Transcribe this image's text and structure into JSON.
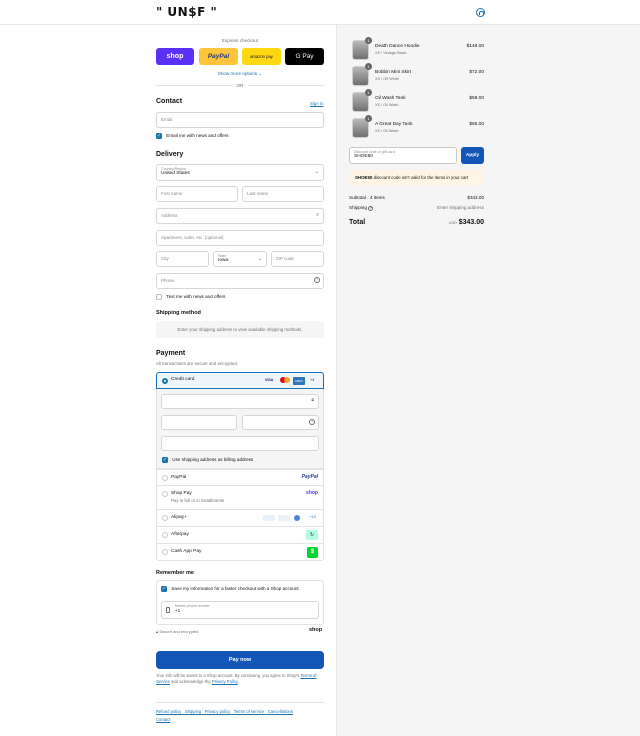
{
  "brand": {
    "logo": "\" UN$F \""
  },
  "express": {
    "title": "Express checkout",
    "shop": "shop",
    "paypal": "PayPal",
    "amazon": "amazon pay",
    "gpay": "G Pay",
    "more": "Show more options",
    "or": "OR"
  },
  "contact": {
    "heading": "Contact",
    "signin": "Sign in",
    "email_placeholder": "Email",
    "news_label": "Email me with news and offers"
  },
  "delivery": {
    "heading": "Delivery",
    "country_label": "Country/Region",
    "country_value": "United States",
    "first_name": "First name",
    "last_name": "Last name",
    "address": "Address",
    "apartment": "Apartment, suite, etc. (optional)",
    "city": "City",
    "state_label": "State",
    "state_value": "Iowa",
    "zip": "ZIP code",
    "phone": "Phone",
    "text_label": "Text me with news and offers"
  },
  "shipping": {
    "heading": "Shipping method",
    "note": "Enter your shipping address to view available shipping methods."
  },
  "payment": {
    "heading": "Payment",
    "subtitle": "All transactions are secure and encrypted.",
    "credit_card": "Credit card",
    "cards": [
      "VISA",
      "MC",
      "AMEX",
      "+4"
    ],
    "billing_label": "Use shipping address as billing address",
    "options": [
      {
        "label": "PayPal",
        "badge": "PayPal"
      },
      {
        "label": "Shop Pay",
        "sub": "Pay in full or in installments",
        "badge": "shop"
      },
      {
        "label": "Alipay+",
        "badge": "+10"
      },
      {
        "label": "Afterpay",
        "badge": "↻"
      },
      {
        "label": "Cash App Pay",
        "badge": "$"
      }
    ]
  },
  "remember": {
    "heading": "Remember me",
    "save_label": "Save my information for a faster checkout with a Shop account",
    "mobile_label": "Mobile phone number",
    "mobile_value": "+1",
    "secure": "Secure and encrypted",
    "shop": "shop"
  },
  "pay_now": "Pay now",
  "legal": {
    "text1": "Your info will be saved to a Shop account. By continuing, you agree to Shop's",
    "terms": "Terms of Service",
    "text2": "and acknowledge the",
    "privacy": "Privacy Policy",
    "end": "."
  },
  "footer_links": [
    "Refund policy",
    "Shipping",
    "Privacy policy",
    "Terms of service",
    "Cancellations",
    "Contact"
  ],
  "cart": {
    "items": [
      {
        "qty": "1",
        "name": "Death Dance Hoodie",
        "variant": "XS / Vintage Black",
        "price": "$148.00"
      },
      {
        "qty": "1",
        "name": "Bobbin Mini Skirt",
        "variant": "XS / Off White",
        "price": "$72.00"
      },
      {
        "qty": "1",
        "name": "Oil Wash Tank",
        "variant": "XS / Oil Wash",
        "price": "$58.00"
      },
      {
        "qty": "1",
        "name": "A Great Day Tank",
        "variant": "XS / Oil Wash",
        "price": "$65.00"
      }
    ],
    "discount_label": "Discount code or gift card",
    "discount_value": "SHOE50",
    "apply": "Apply",
    "error_code": "SHOE50",
    "error_text": "discount code isn't valid for the items in your cart",
    "subtotal_label": "Subtotal · 4 items",
    "subtotal_value": "$343.00",
    "shipping_label": "Shipping",
    "shipping_value": "Enter shipping address",
    "total_label": "Total",
    "currency": "USD",
    "total_value": "$343.00"
  }
}
